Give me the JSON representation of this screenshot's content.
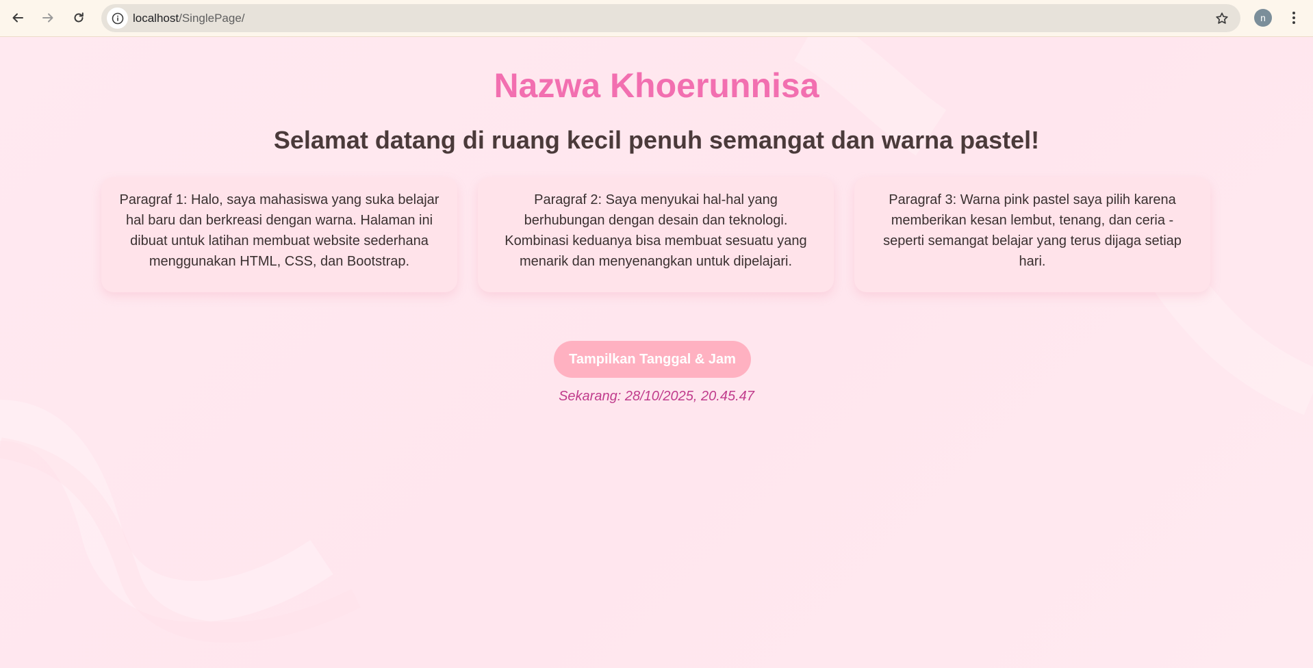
{
  "browser": {
    "url_host": "localhost",
    "url_path": "/SinglePage/",
    "profile_initial": "n",
    "icons": {
      "back": "back-arrow-icon",
      "forward": "forward-arrow-icon",
      "reload": "reload-icon",
      "site_info": "info-icon",
      "bookmark": "star-icon",
      "menu": "kebab-menu-icon"
    }
  },
  "page": {
    "title": "Nazwa Khoerunnisa",
    "subtitle": "Selamat datang di ruang kecil penuh semangat dan warna pastel!",
    "paragraphs": [
      "Paragraf 1: Halo, saya mahasiswa yang suka belajar hal baru dan berkreasi dengan warna. Halaman ini dibuat untuk latihan membuat website sederhana menggunakan HTML, CSS, dan Bootstrap.",
      "Paragraf 2: Saya menyukai hal-hal yang berhubungan dengan desain dan teknologi. Kombinasi keduanya bisa membuat sesuatu yang menarik dan menyenangkan untuk dipelajari.",
      "Paragraf 3: Warna pink pastel saya pilih karena memberikan kesan lembut, tenang, dan ceria - seperti semangat belajar yang terus dijaga setiap hari."
    ],
    "button_label": "Tampilkan Tanggal & Jam",
    "datetime_text": "Sekarang: 28/10/2025, 20.45.47"
  },
  "colors": {
    "background": "#ffe8ef",
    "title": "#f26fb0",
    "button": "#ffb1c1",
    "datetime": "#c03c8c",
    "card": "#ffe3ea"
  }
}
